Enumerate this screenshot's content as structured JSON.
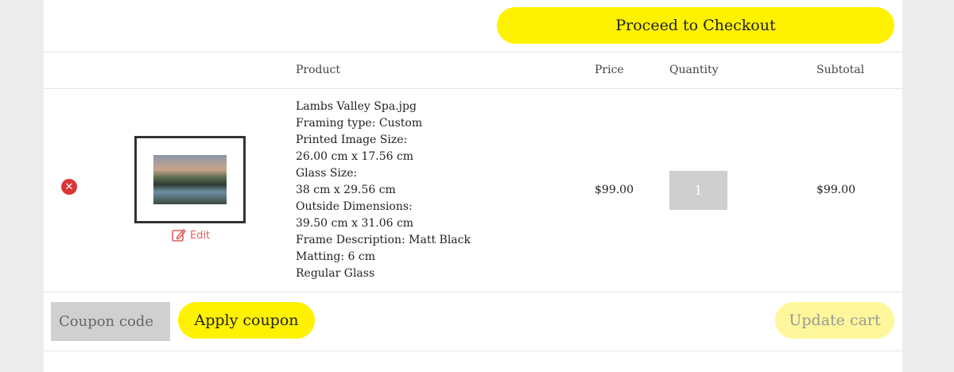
{
  "header": {
    "checkout_label": "Proceed to Checkout"
  },
  "table": {
    "columns": {
      "product": "Product",
      "price": "Price",
      "quantity": "Quantity",
      "subtotal": "Subtotal"
    }
  },
  "item": {
    "remove_icon": "remove-x-icon",
    "edit_label": "Edit",
    "details": [
      "Lambs Valley Spa.jpg",
      "Framing type: Custom",
      "Printed Image Size:",
      "26.00 cm x 17.56 cm",
      "Glass Size:",
      "38 cm x 29.56 cm",
      "Outside Dimensions:",
      "39.50 cm x 31.06 cm",
      "Frame Description: Matt Black",
      "Matting: 6 cm",
      "Regular Glass"
    ],
    "price": "$99.00",
    "quantity": "1",
    "subtotal": "$99.00"
  },
  "actions": {
    "coupon_placeholder": "Coupon code",
    "apply_label": "Apply coupon",
    "update_label": "Update cart"
  },
  "colors": {
    "accent": "#fff200",
    "accent_disabled": "#fff79c",
    "remove": "#d93636",
    "edit": "#e06060"
  }
}
